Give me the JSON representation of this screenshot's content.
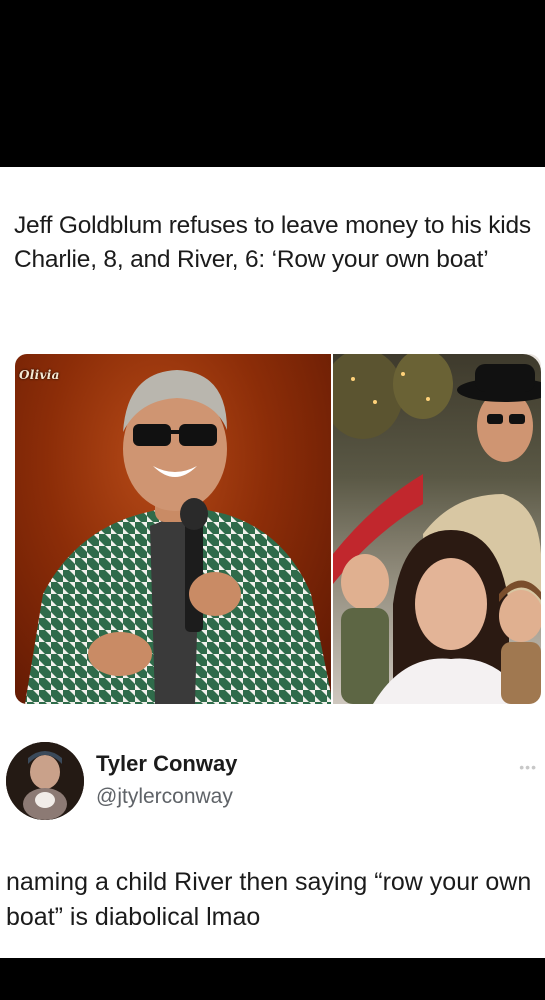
{
  "article": {
    "headline": "Jeff Goldblum refuses to leave money to his kids Charlie, 8, and River, 6: ‘Row your own boat’",
    "photo_watermark": "Olivia"
  },
  "tweet": {
    "author_name": "Tyler Conway",
    "author_handle": "@jtylerconway",
    "text": "naming a child River then saying “row your own boat” is diabolical lmao",
    "more_icon": "•••"
  },
  "colors": {
    "background": "#000000",
    "card": "#ffffff",
    "text": "#1b1b1b",
    "handle": "#5f6368"
  }
}
